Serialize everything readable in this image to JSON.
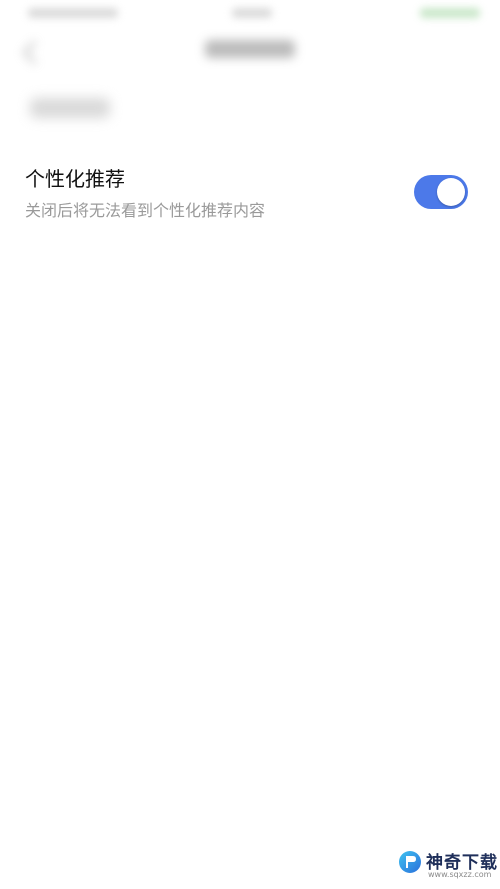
{
  "setting": {
    "title": "个性化推荐",
    "description": "关闭后将无法看到个性化推荐内容",
    "toggle_state": "on",
    "accent_color": "#4c79e9"
  },
  "watermark": {
    "name": "神奇下载",
    "url": "www.sqxzz.com"
  }
}
